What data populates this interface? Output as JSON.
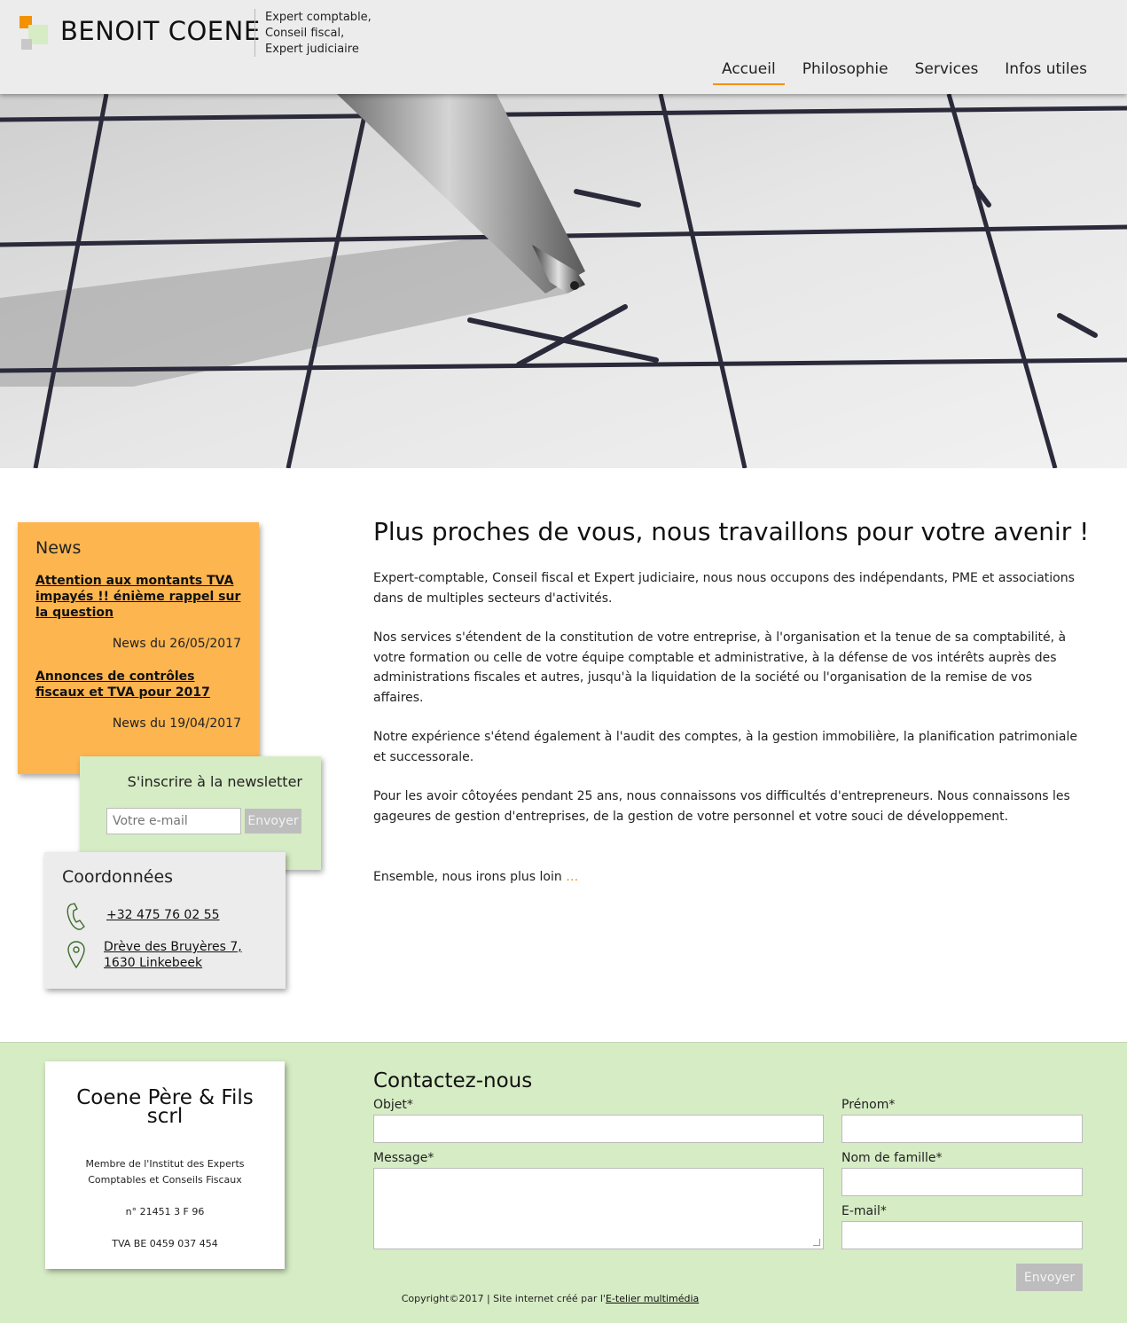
{
  "header": {
    "brand": "BENOIT COENE",
    "tagline": [
      "Expert comptable,",
      "Conseil fiscal,",
      "Expert judiciaire"
    ],
    "nav": [
      {
        "label": "Accueil",
        "active": true
      },
      {
        "label": "Philosophie",
        "active": false
      },
      {
        "label": "Services",
        "active": false
      },
      {
        "label": "Infos utiles",
        "active": false
      }
    ]
  },
  "colors": {
    "accent_orange": "#f39200",
    "news_bg": "#fdb54f",
    "green_bg": "#d6ecc5",
    "grey_bg": "#ececec",
    "button_grey": "#bdbdbd"
  },
  "news": {
    "title": "News",
    "items": [
      {
        "title": "Attention aux montants TVA impayés !! énième rappel sur la question",
        "date": "News du 26/05/2017"
      },
      {
        "title": "Annonces de contrôles fiscaux et TVA pour 2017",
        "date": "News du 19/04/2017"
      }
    ]
  },
  "newsletter": {
    "title": "S'inscrire à la newsletter",
    "placeholder": "Votre e-mail",
    "button": "Envoyer"
  },
  "coordonnees": {
    "title": "Coordonnées",
    "phone": "+32 475 76 02 55",
    "address_line1": "Drève des Bruyères 7,",
    "address_line2": "1630 Linkebeek",
    "phone_icon": "phone-icon",
    "location_icon": "map-pin-icon"
  },
  "main": {
    "heading": "Plus proches de vous, nous travaillons pour votre avenir !",
    "paragraphs": [
      "Expert-comptable, Conseil fiscal et Expert judiciaire, nous nous occupons des indépendants, PME et associations dans de multiples secteurs d'activités.",
      "Nos services s'étendent de la constitution de votre entreprise, à l'organisation et la tenue de sa comptabilité, à votre formation ou celle de votre équipe comptable et administrative, à la défense de vos intérêts auprès des administrations fiscales et autres, jusqu'à la liquidation de la société ou l'organisation de la remise de vos affaires.",
      "Notre expérience s'étend également à l'audit des comptes, à la gestion immobilière, la planification patrimoniale et successorale.",
      "Pour les avoir côtoyées pendant 25 ans, nous connaissons vos difficultés d'entrepreneurs.  Nous connaissons les gageures de gestion d'entreprises, de la gestion de votre personnel et votre souci de développement."
    ],
    "closing": "Ensemble, nous irons plus loin",
    "closing_ellipsis": "…"
  },
  "footer": {
    "company_name_line1": "Coene Père & Fils",
    "company_name_line2": "scrl",
    "member_line1": "Membre de l'Institut des Experts",
    "member_line2": "Comptables et Conseils Fiscaux",
    "registration": "n° 21451 3 F 96",
    "vat": "TVA BE 0459 037 454",
    "contact_title": "Contactez-nous",
    "labels": {
      "objet": "Objet*",
      "message": "Message*",
      "prenom": "Prénom*",
      "nom": "Nom de famille*",
      "email": "E-mail*"
    },
    "submit": "Envoyer",
    "copyright_prefix": "Copyright©2017 | Site internet créé par l'",
    "copyright_link": "E-telier multimédia"
  }
}
